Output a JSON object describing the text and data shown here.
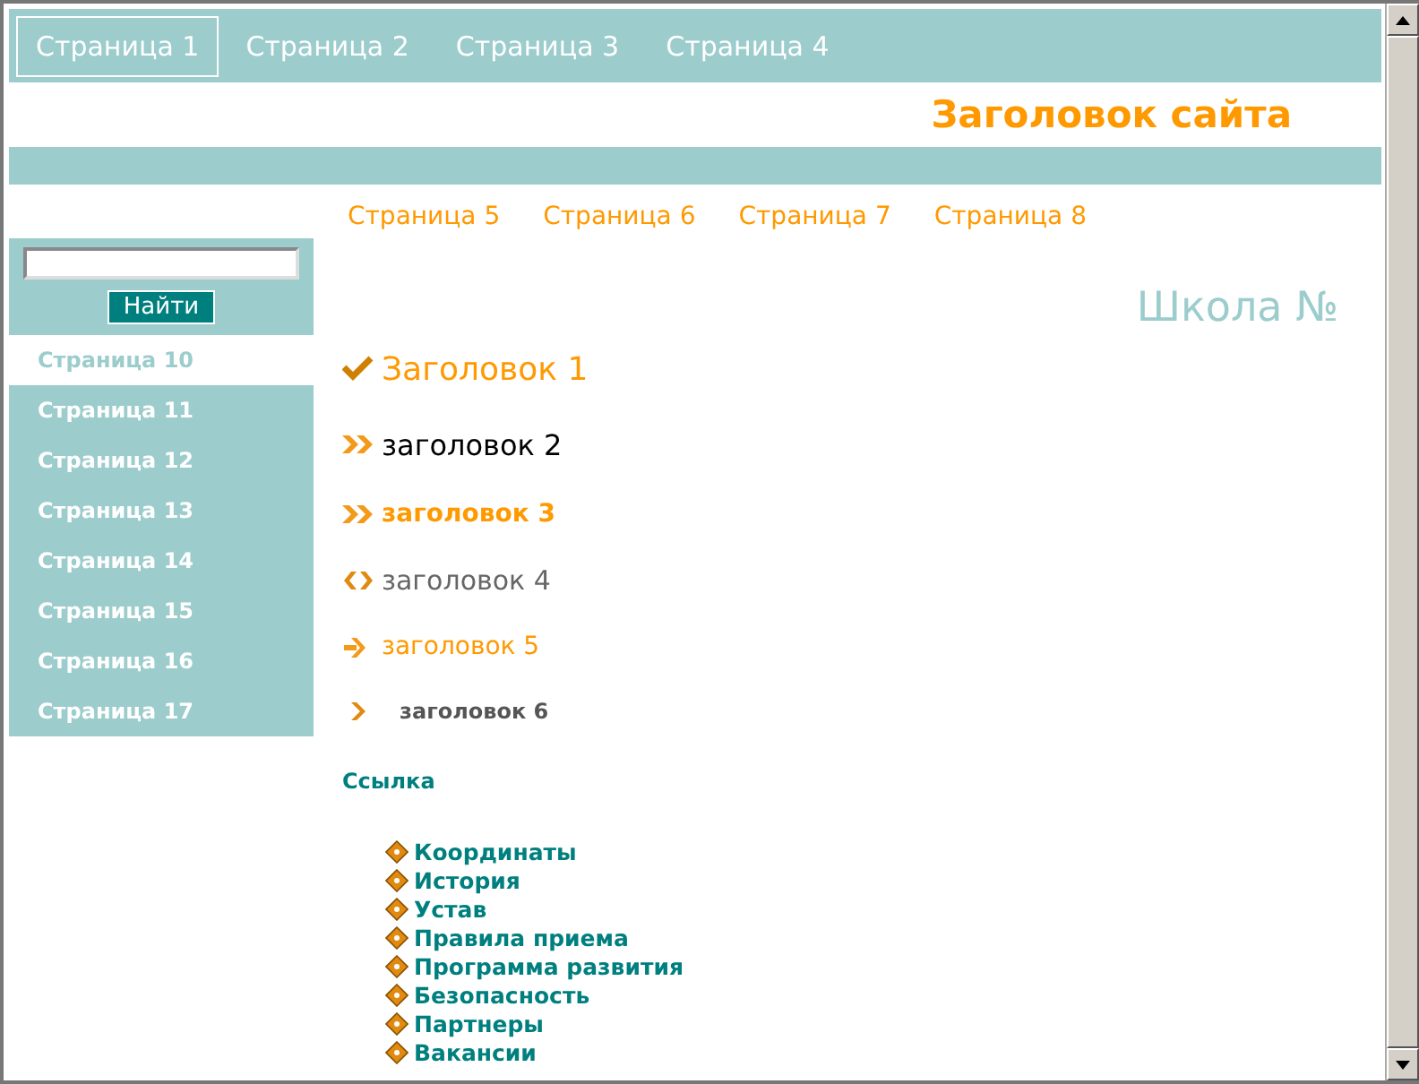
{
  "top_nav": [
    {
      "label": "Страница 1",
      "selected": true
    },
    {
      "label": "Страница 2",
      "selected": false
    },
    {
      "label": "Страница 3",
      "selected": false
    },
    {
      "label": "Страница 4",
      "selected": false
    }
  ],
  "site_title": "Заголовок сайта",
  "sub_nav": [
    "Страница 5",
    "Страница 6",
    "Страница 7",
    "Страница 8"
  ],
  "sidebar": {
    "search_button": "Найти",
    "items": [
      {
        "label": "Страница 10",
        "selected": true
      },
      {
        "label": "Страница 11",
        "selected": false
      },
      {
        "label": "Страница 12",
        "selected": false
      },
      {
        "label": "Страница 13",
        "selected": false
      },
      {
        "label": "Страница 14",
        "selected": false
      },
      {
        "label": "Страница 15",
        "selected": false
      },
      {
        "label": "Страница 16",
        "selected": false
      },
      {
        "label": "Страница 17",
        "selected": false
      }
    ]
  },
  "school_title": "Школа №",
  "headings": [
    {
      "kind": "check",
      "text": "Заголовок 1"
    },
    {
      "kind": "double",
      "text": "заголовок 2"
    },
    {
      "kind": "doublebold",
      "text": "заголовок 3"
    },
    {
      "kind": "diamond",
      "text": "заголовок 4"
    },
    {
      "kind": "arrow",
      "text": "заголовок 5"
    },
    {
      "kind": "chevron",
      "text": "заголовок 6"
    }
  ],
  "link_title": "Ссылка",
  "links": [
    "Координаты",
    "История",
    "Устав",
    "Правила приема",
    "Программа развития",
    "Безопасность",
    "Партнеры",
    "Вакансии"
  ]
}
